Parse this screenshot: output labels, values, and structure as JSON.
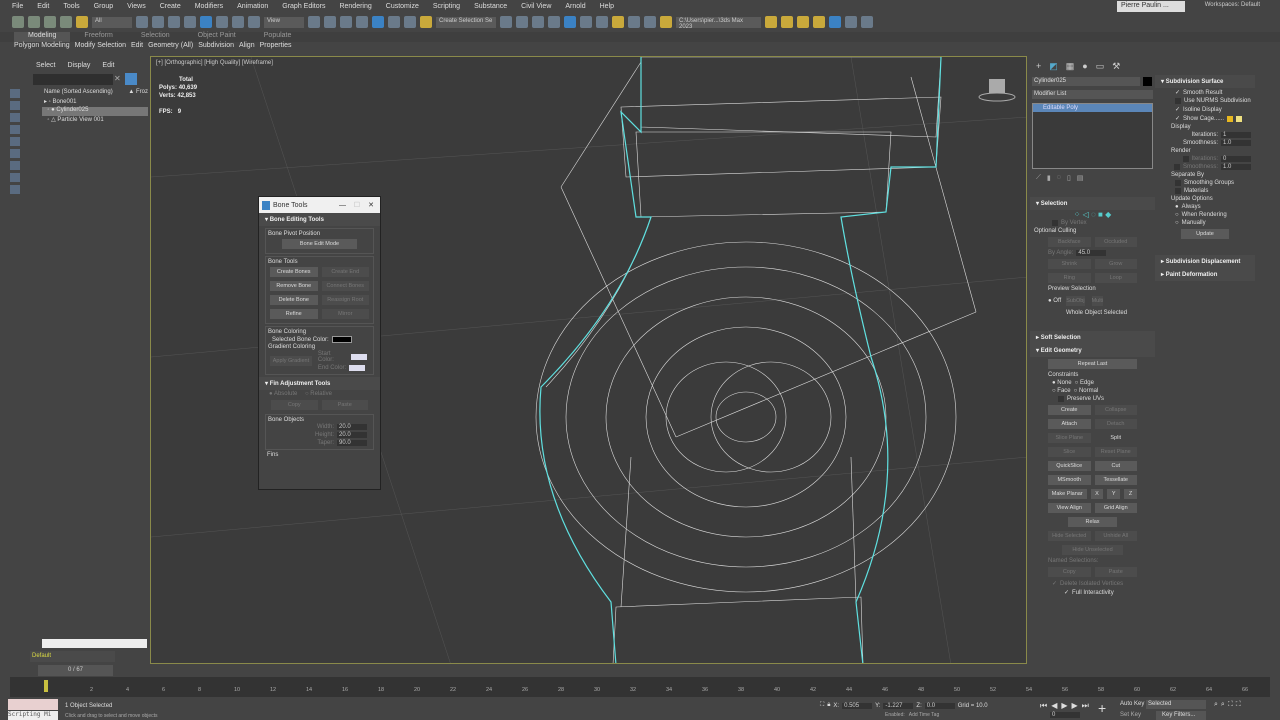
{
  "menu": [
    "File",
    "Edit",
    "Tools",
    "Group",
    "Views",
    "Create",
    "Modifiers",
    "Animation",
    "Graph Editors",
    "Rendering",
    "Customize",
    "Scripting",
    "Substance",
    "Civil View",
    "Arnold",
    "Help"
  ],
  "toolbar": {
    "filter": "All",
    "view": "View",
    "selection_set": "Create Selection Se",
    "path": "C:\\Users\\pier...\\3ds Max 2023"
  },
  "user": "Pierre Paulin ...",
  "workspaces_label": "Workspaces:",
  "workspace": "Default",
  "ribbon_tabs": [
    "Modeling",
    "Freeform",
    "Selection",
    "Object Paint",
    "Populate"
  ],
  "ribbon_panels": [
    "Polygon Modeling",
    "Modify Selection",
    "Edit",
    "Geometry (All)",
    "Subdivision",
    "Align",
    "Properties"
  ],
  "scene": {
    "tabs": [
      "Select",
      "Display",
      "Edit"
    ],
    "column": "Name (Sorted Ascending)",
    "column2": "▲ Froz",
    "items": [
      "Bone001",
      "Cylinder025",
      "Particle View 001"
    ],
    "layer": "Default"
  },
  "viewport": {
    "label": "[+] [Orthographic] [High Quality] [Wireframe]",
    "total": "Total",
    "polys_label": "Polys:",
    "polys": "40,639",
    "verts_label": "Verts:",
    "verts": "42,853",
    "fps_label": "FPS:",
    "fps": "9"
  },
  "bone_tools": {
    "title": "Bone Tools",
    "rollout1": "Bone Editing Tools",
    "pivot_group": "Bone Pivot Position",
    "edit_mode": "Bone Edit Mode",
    "tools_group": "Bone Tools",
    "create_bones": "Create Bones",
    "create_end": "Create End",
    "remove_bone": "Remove Bone",
    "connect_bones": "Connect Bones",
    "delete_bone": "Delete Bone",
    "reassign_root": "Reassign Root",
    "refine": "Refine",
    "mirror": "Mirror",
    "coloring_group": "Bone Coloring",
    "selected_color": "Selected Bone Color:",
    "gradient_group": "Gradient Coloring",
    "apply_gradient": "Apply Gradient",
    "start_color": "Start Color:",
    "end_color": "End Color:",
    "rollout2": "Fin Adjustment Tools",
    "absolute": "Absolute",
    "relative": "Relative",
    "copy": "Copy",
    "paste": "Paste",
    "objects_group": "Bone Objects",
    "width_label": "Width:",
    "width": "20.0",
    "height_label": "Height:",
    "height": "20.0",
    "taper_label": "Taper:",
    "taper": "90.0",
    "fins": "Fins"
  },
  "command": {
    "object_name": "Cylinder025",
    "modifier_list": "Modifier List",
    "stack_item": "Editable Poly",
    "selection": "Selection",
    "by_vertex": "By Vertex",
    "optional_culling": "Optional Culling",
    "backface": "Backface",
    "occluded": "Occluded",
    "by_angle": "By Angle:",
    "angle": "45.0",
    "shrink": "Shrink",
    "grow": "Grow",
    "ring": "Ring",
    "loop": "Loop",
    "preview": "Preview Selection",
    "off": "Off",
    "subobj": "SubObj",
    "multi": "Multi",
    "whole": "Whole Object Selected",
    "soft_selection": "Soft Selection",
    "edit_geometry": "Edit Geometry",
    "repeat_last": "Repeat Last",
    "constraints": "Constraints",
    "none": "None",
    "edge": "Edge",
    "face": "Face",
    "normal": "Normal",
    "preserve_uvs": "Preserve UVs",
    "create": "Create",
    "collapse": "Collapse",
    "attach": "Attach",
    "detach": "Detach",
    "slice_plane": "Slice Plane",
    "split": "Split",
    "slice": "Slice",
    "reset_plane": "Reset Plane",
    "quickslice": "QuickSlice",
    "cut": "Cut",
    "msmooth": "MSmooth",
    "tessellate": "Tessellate",
    "make_planar": "Make Planar",
    "x": "X",
    "y": "Y",
    "z": "Z",
    "view_align": "View Align",
    "grid_align": "Grid Align",
    "relax": "Relax",
    "hide_selected": "Hide Selected",
    "unhide_all": "Unhide All",
    "hide_unselected": "Hide Unselected",
    "named_sel": "Named Selections:",
    "copy": "Copy",
    "paste": "Paste",
    "delete_isolated": "Delete Isolated Vertices",
    "full_interactivity": "Full Interactivity"
  },
  "subdiv": {
    "title": "Subdivision Surface",
    "smooth_result": "Smooth Result",
    "use_nurms": "Use NURMS Subdivision",
    "isoline": "Isoline Display",
    "show_cage": "Show Cage......",
    "display": "Display",
    "iterations_label": "Iterations:",
    "iterations": "1",
    "smoothness_label": "Smoothness:",
    "smoothness": "1.0",
    "render": "Render",
    "r_iterations": "0",
    "r_smoothness": "1.0",
    "separate_by": "Separate By",
    "smoothing_groups": "Smoothing Groups",
    "materials": "Materials",
    "update_options": "Update Options",
    "always": "Always",
    "when_rendering": "When Rendering",
    "manually": "Manually",
    "update": "Update",
    "displacement": "Subdivision Displacement",
    "paint_deformation": "Paint Deformation"
  },
  "timeline": {
    "frame": "0 / 67",
    "ticks": [
      "2",
      "4",
      "6",
      "8",
      "10",
      "12",
      "14",
      "16",
      "18",
      "20",
      "22",
      "24",
      "26",
      "28",
      "30",
      "32",
      "34",
      "36",
      "38",
      "40",
      "42",
      "44",
      "46",
      "48",
      "50",
      "52",
      "54",
      "56",
      "58",
      "60",
      "62",
      "64",
      "66"
    ]
  },
  "status": {
    "objects": "1 Object Selected",
    "hint": "Click and drag to select and move objects",
    "script": "Scripting Mi",
    "x_label": "X:",
    "x": "0.505",
    "y_label": "Y:",
    "y": "-1.227",
    "z_label": "Z:",
    "z": "0.0",
    "grid": "Grid = 10.0",
    "auto_key": "Auto Key",
    "set_key": "Set Key",
    "selected": "Selected",
    "key_filters": "Key Filters...",
    "time_value": "0",
    "enabled": "Enabled:",
    "add_time_tag": "Add Time Tag"
  },
  "colors": {
    "accent": "#3b82c4",
    "wire_selected": "#5fe0e0",
    "bg": "#444444",
    "viewport": "#3b3b3b"
  }
}
